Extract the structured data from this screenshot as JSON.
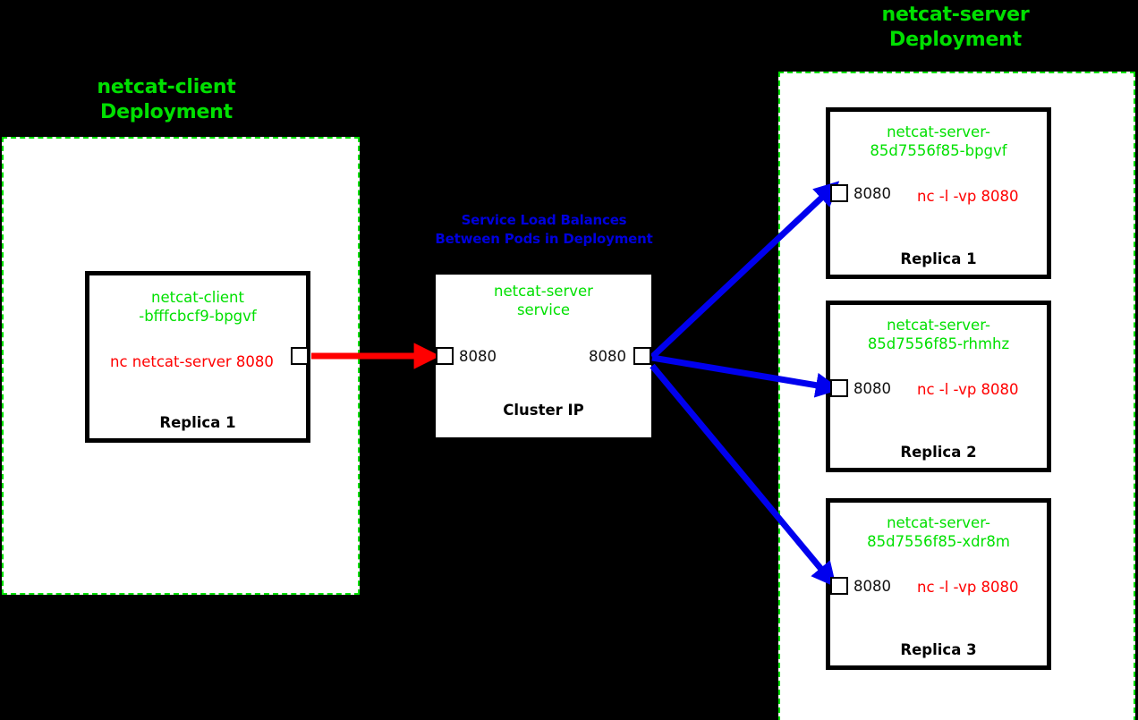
{
  "diagram": {
    "background_color": "#000000",
    "client_deployment": {
      "title": "netcat-client\nDeployment",
      "title_color": "#00e000",
      "border_color": "#00e000",
      "pod": {
        "name": "netcat-client\n-bfffcbcf9-bpgvf",
        "command": "nc netcat-server 8080",
        "command_color": "#ff0000",
        "replica_label": "Replica 1",
        "port": "8080"
      }
    },
    "service": {
      "annotation": "Service Load Balances\nBetween Pods in Deployment",
      "annotation_color": "#0000dd",
      "name": "netcat-server\nservice",
      "type_label": "Cluster IP",
      "ingress_port": "8080",
      "egress_port": "8080"
    },
    "server_deployment": {
      "title": "netcat-server\nDeployment",
      "title_color": "#00e000",
      "border_color": "#00e000",
      "pods": [
        {
          "name": "netcat-server-\n85d7556f85-bpgvf",
          "command": "nc -l -vp 8080",
          "command_color": "#ff0000",
          "replica_label": "Replica 1",
          "port": "8080"
        },
        {
          "name": "netcat-server-\n85d7556f85-rhmhz",
          "command": "nc -l -vp 8080",
          "command_color": "#ff0000",
          "replica_label": "Replica 2",
          "port": "8080"
        },
        {
          "name": "netcat-server-\n85d7556f85-xdr8m",
          "command": "nc -l -vp 8080",
          "command_color": "#ff0000",
          "replica_label": "Replica 3",
          "port": "8080"
        }
      ]
    },
    "connections": {
      "client_to_service_color": "#ff0000",
      "service_to_pods_color": "#0000ee"
    }
  }
}
